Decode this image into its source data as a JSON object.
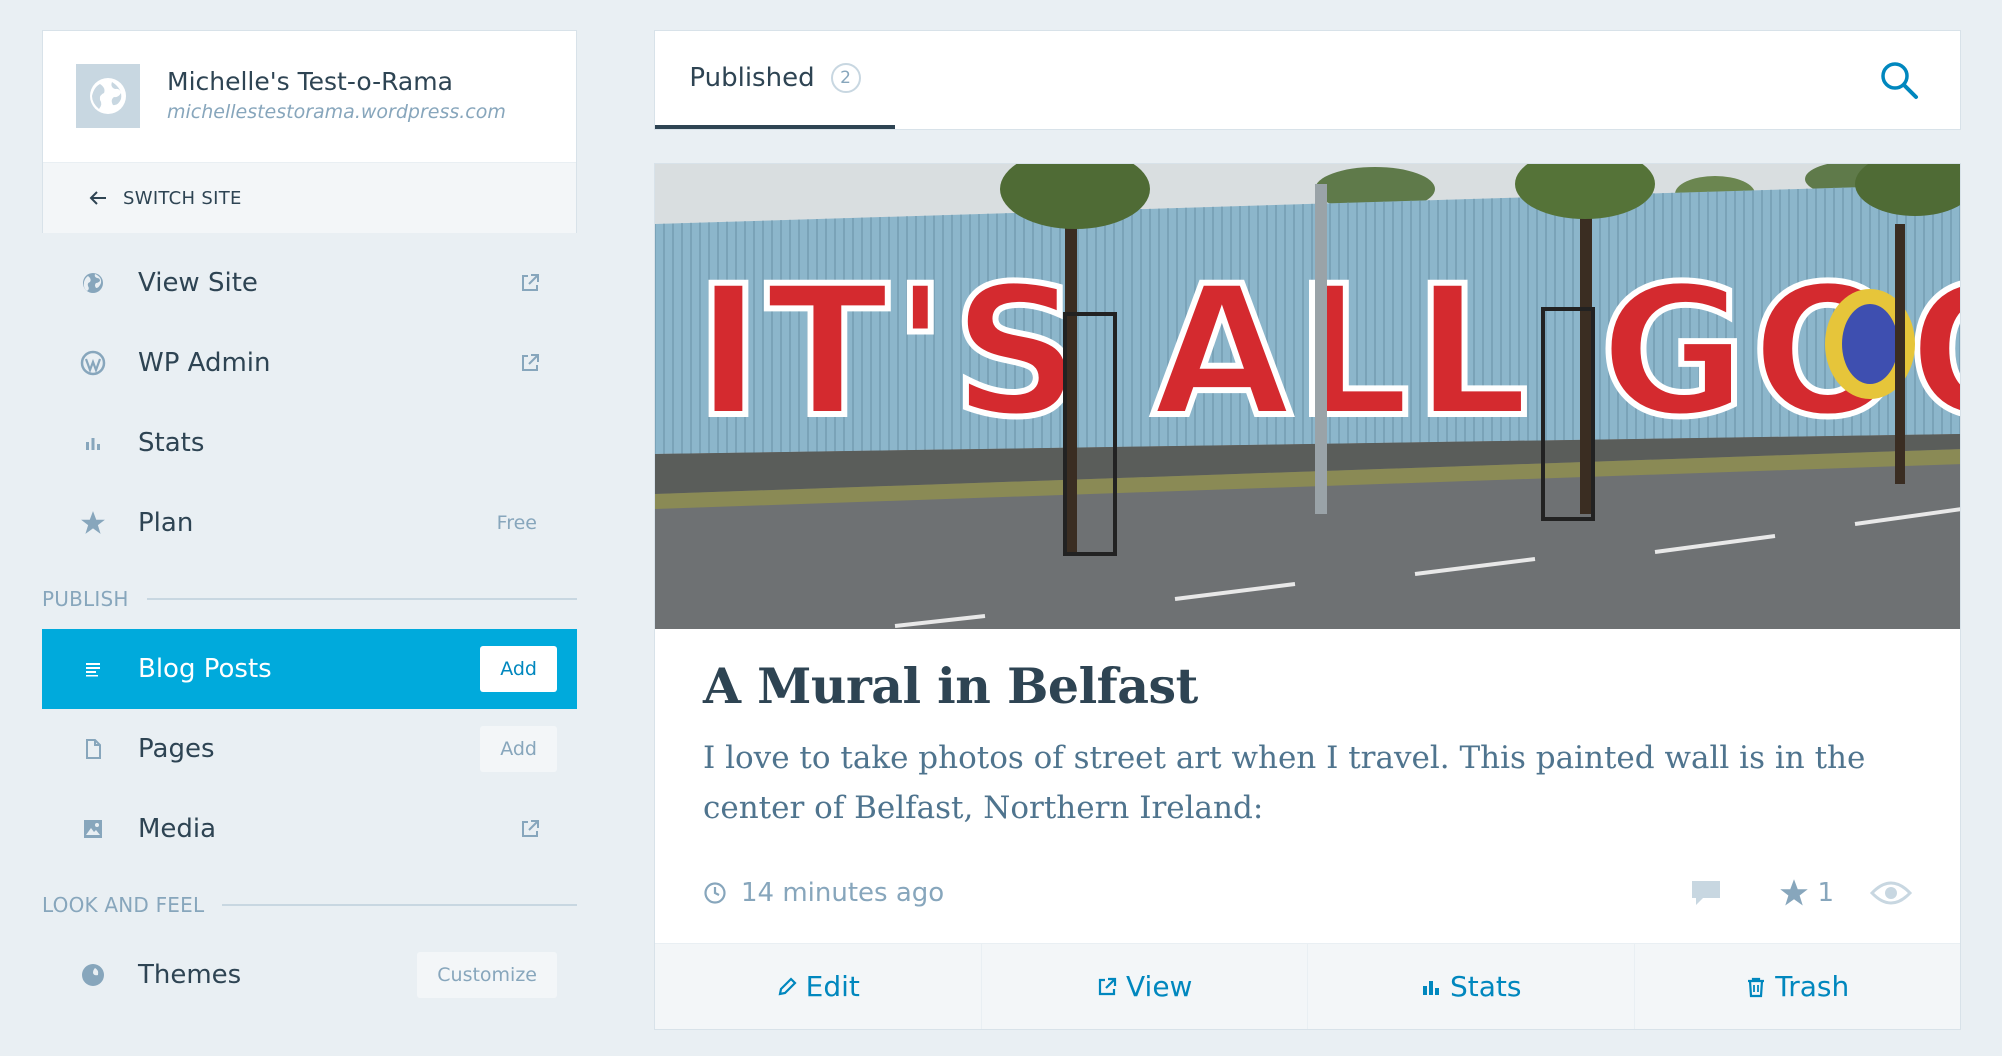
{
  "site": {
    "title": "Michelle's Test-o-Rama",
    "url": "michellestestorama.wordpress.com",
    "switch_label": "SWITCH SITE"
  },
  "menu": {
    "top": [
      {
        "label": "View Site",
        "icon": "globe-icon",
        "external": true
      },
      {
        "label": "WP Admin",
        "icon": "wordpress-icon",
        "external": true
      },
      {
        "label": "Stats",
        "icon": "stats-icon"
      },
      {
        "label": "Plan",
        "icon": "star-icon",
        "badge": "Free"
      }
    ],
    "publish_heading": "PUBLISH",
    "publish": [
      {
        "label": "Blog Posts",
        "icon": "posts-icon",
        "button": "Add",
        "active": true
      },
      {
        "label": "Pages",
        "icon": "page-icon",
        "button": "Add"
      },
      {
        "label": "Media",
        "icon": "image-icon",
        "external": true
      }
    ],
    "look_heading": "LOOK AND FEEL",
    "look": [
      {
        "label": "Themes",
        "icon": "themes-icon",
        "button": "Customize"
      }
    ]
  },
  "tabs": {
    "active_label": "Published",
    "active_count": "2"
  },
  "post": {
    "image_text": "IT'S ALL GOOD",
    "title": "A Mural in Belfast",
    "excerpt": "I love to take photos of street art when I travel. This painted wall is in the center of Belfast, Northern Ireland:",
    "time": "14 minutes ago",
    "likes": "1",
    "actions": {
      "edit": "Edit",
      "view": "View",
      "stats": "Stats",
      "trash": "Trash"
    }
  },
  "colors": {
    "accent": "#00aadc",
    "link": "#0087be",
    "text": "#2e4453",
    "muted": "#87a6bc",
    "background": "#e9eff3"
  }
}
